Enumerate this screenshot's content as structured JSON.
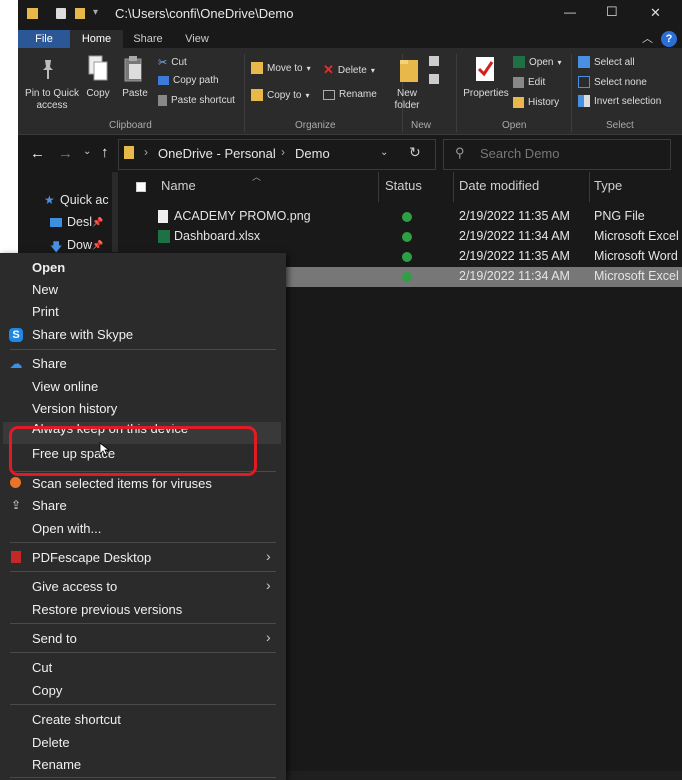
{
  "window": {
    "path": "C:\\Users\\confi\\OneDrive\\Demo",
    "controls": {
      "minimize": "—",
      "maximize": "☐",
      "close": "✕"
    }
  },
  "tabs": [
    "File",
    "Home",
    "Share",
    "View"
  ],
  "help": "?",
  "ribbon": {
    "clipboard": {
      "pin": "Pin to Quick access",
      "copy": "Copy",
      "paste": "Paste",
      "cut": "Cut",
      "copy_path": "Copy path",
      "paste_shortcut": "Paste shortcut",
      "label": "Clipboard"
    },
    "organize": {
      "move_to": "Move to",
      "copy_to": "Copy to",
      "delete": "Delete",
      "rename": "Rename",
      "label": "Organize"
    },
    "new": {
      "new_folder": "New folder",
      "label": "New"
    },
    "open": {
      "properties": "Properties",
      "open": "Open",
      "edit": "Edit",
      "history": "History",
      "label": "Open"
    },
    "select": {
      "select_all": "Select all",
      "select_none": "Select none",
      "invert": "Invert selection",
      "label": "Select"
    }
  },
  "address": {
    "crumbs": [
      "OneDrive - Personal",
      "Demo"
    ],
    "search_placeholder": "Search Demo"
  },
  "nav": [
    "Quick ac",
    "Desl",
    "Dow"
  ],
  "columns": {
    "name": "Name",
    "status": "Status",
    "date": "Date modified",
    "type": "Type"
  },
  "files": [
    {
      "name": "ACADEMY PROMO.png",
      "date": "2/19/2022 11:35 AM",
      "type": "PNG File"
    },
    {
      "name": "Dashboard.xlsx",
      "date": "2/19/2022 11:34 AM",
      "type": "Microsoft Excel"
    },
    {
      "name": "",
      "date": "2/19/2022 11:35 AM",
      "type": "Microsoft Word"
    },
    {
      "name": "",
      "date": "2/19/2022 11:34 AM",
      "type": "Microsoft Excel"
    }
  ],
  "context_menu": {
    "open": "Open",
    "new": "New",
    "print": "Print",
    "share_skype": "Share with Skype",
    "share_onedrive": "Share",
    "view_online": "View online",
    "version_history": "Version history",
    "always_keep": "Always keep on this device",
    "free_up_space": "Free up space",
    "scan": "Scan selected items for viruses",
    "share": "Share",
    "open_with": "Open with...",
    "pdfescape": "PDFescape Desktop",
    "give_access": "Give access to",
    "restore": "Restore previous versions",
    "send_to": "Send to",
    "cut": "Cut",
    "copy": "Copy",
    "create_shortcut": "Create shortcut",
    "delete": "Delete",
    "rename": "Rename"
  },
  "colors": {
    "accent": "#2b5797",
    "status_ok": "#2ea043",
    "highlight_box": "#e01b24",
    "selection": "#777777"
  }
}
